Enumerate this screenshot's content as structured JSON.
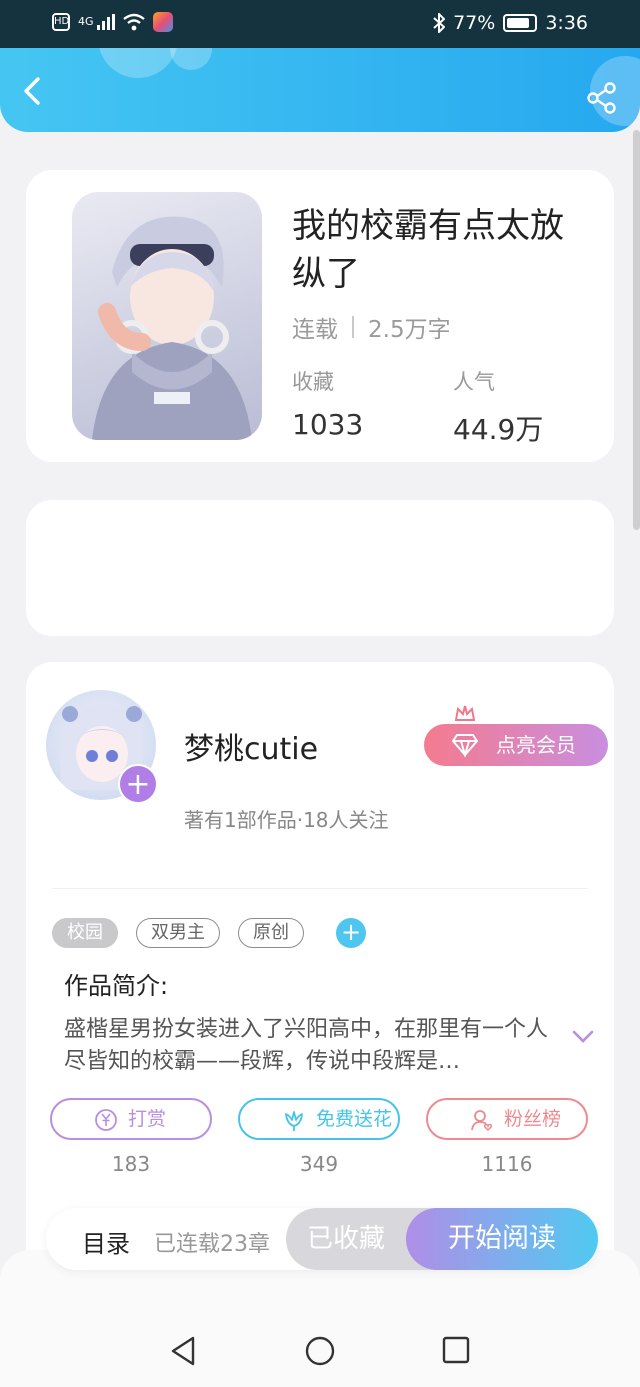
{
  "status_bar": {
    "network_badge": "HD",
    "signal_label": "4G",
    "battery_percent": "77%",
    "time": "3:36"
  },
  "book": {
    "title": "我的校霸有点太放纵了",
    "status": "连载",
    "word_count": "2.5万字",
    "favorites_label": "收藏",
    "favorites_value": "1033",
    "popularity_label": "人气",
    "popularity_value": "44.9万"
  },
  "author": {
    "name": "梦桃cutie",
    "subtitle": "著有1部作品·18人关注",
    "vip_label": "点亮会员",
    "follow_symbol": "+"
  },
  "tags": [
    "校园",
    "双男主",
    "原创"
  ],
  "tag_add_symbol": "+",
  "intro": {
    "title": "作品简介:",
    "text": "盛楷星男扮女装进入了兴阳高中，在那里有一个人尽皆知的校霸——段辉，传说中段辉是…"
  },
  "actions": [
    {
      "label": "打赏",
      "count": "183",
      "color": "#b88ee0",
      "icon": "yen-coin-icon"
    },
    {
      "label": "免费送花",
      "count": "349",
      "color": "#45c4ea",
      "icon": "flower-icon"
    },
    {
      "label": "粉丝榜",
      "count": "1116",
      "color": "#ee8a8f",
      "icon": "fan-user-icon"
    }
  ],
  "bottom_bar": {
    "toc_label": "目录",
    "chapter_count": "已连载23章",
    "favorited_label": "已收藏",
    "read_label": "开始阅读"
  },
  "colors": {
    "header_start": "#45c6f2",
    "header_end": "#26a8f0",
    "accent_purple": "#b07ee6",
    "vip_start": "#f47b8e",
    "vip_end": "#c98ee0"
  }
}
